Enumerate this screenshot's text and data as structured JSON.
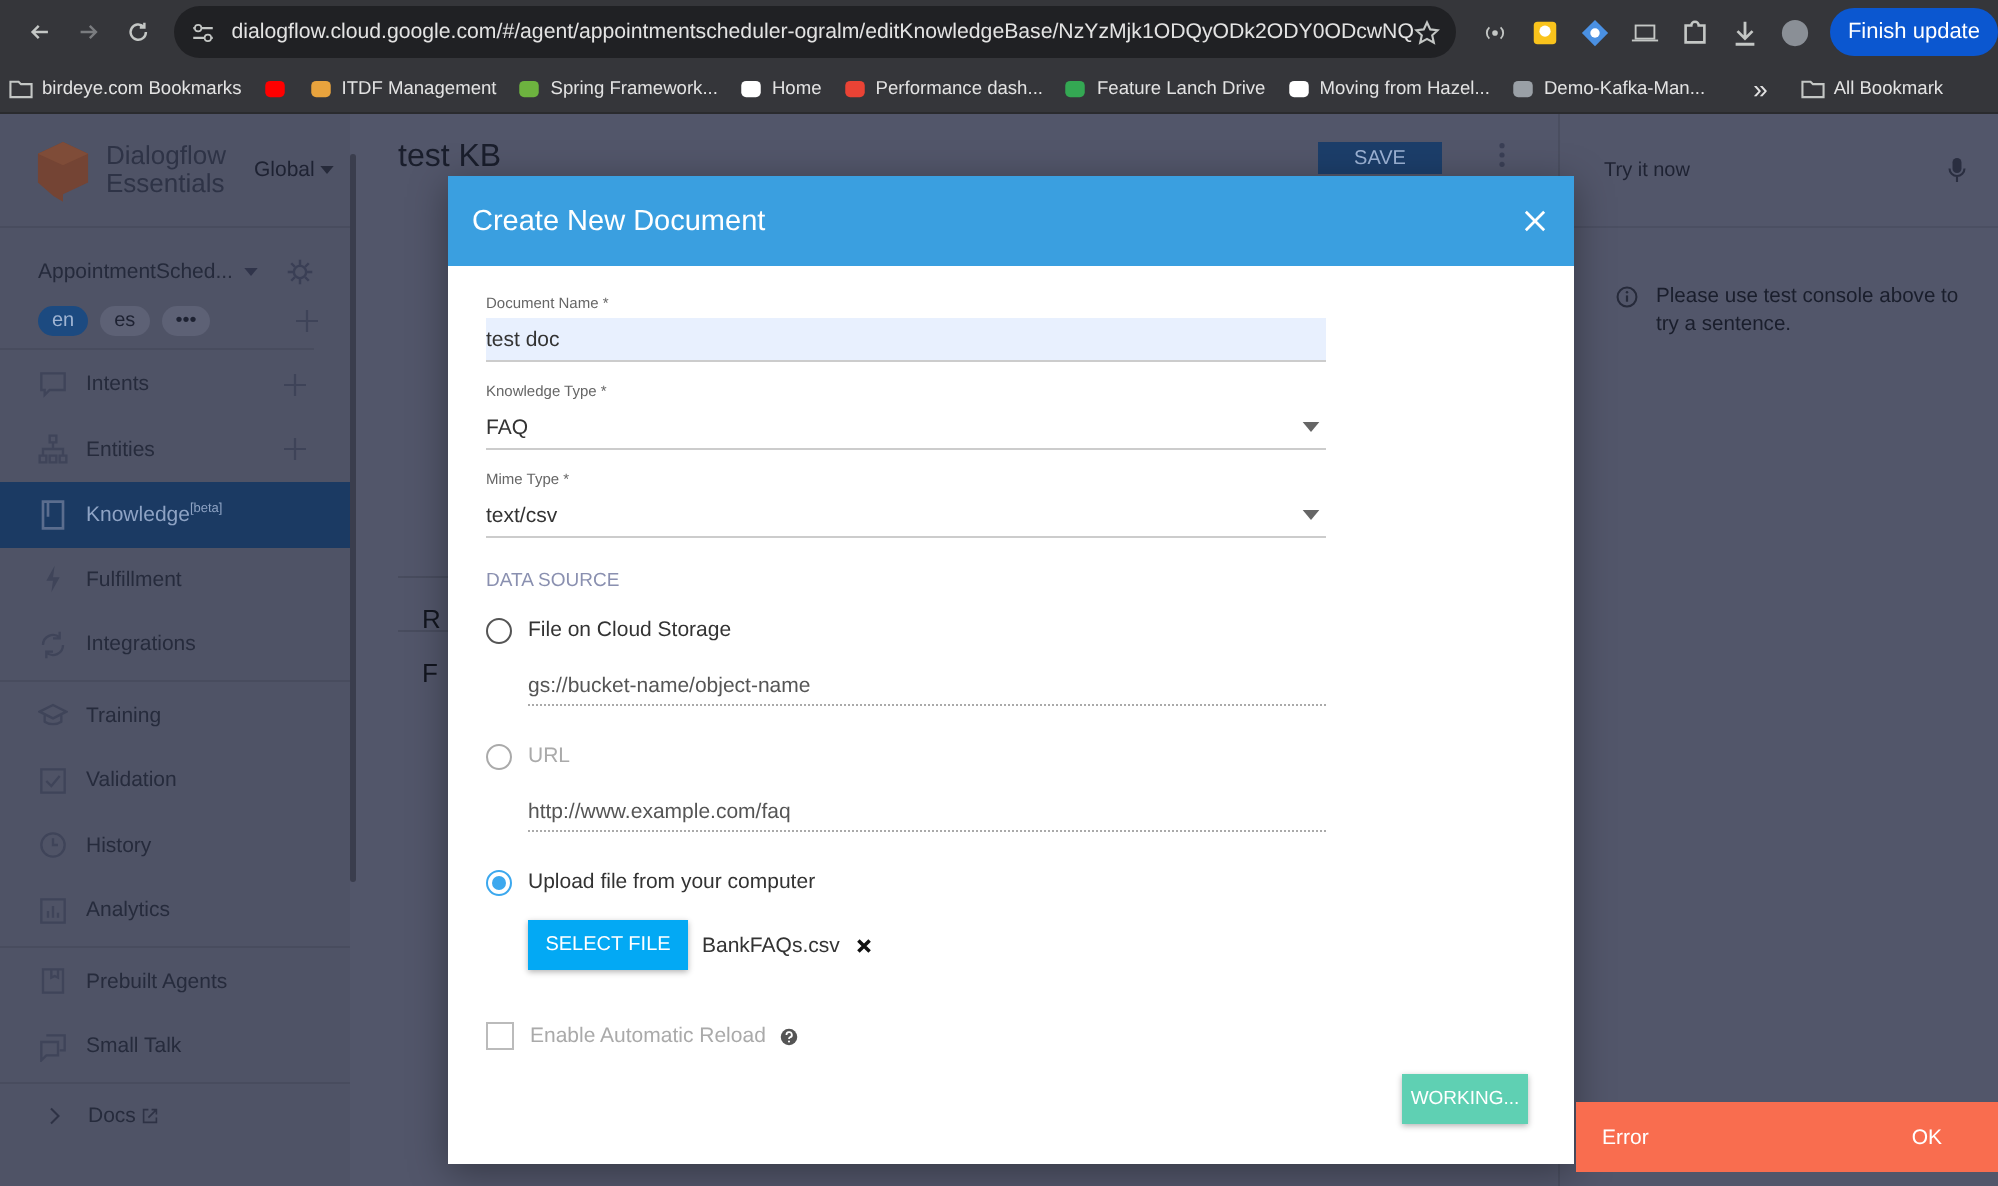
{
  "browser": {
    "url": "dialogflow.cloud.google.com/#/agent/appointmentscheduler-ogralm/editKnowledgeBase/NzYzMjk1ODQyODk2ODY0ODcwNQ",
    "update_button": "Finish update",
    "bookmarks": [
      {
        "kind": "folder",
        "label": "birdeye.com Bookmarks"
      },
      {
        "kind": "icon"
      },
      {
        "kind": "link",
        "label": "ITDF Management"
      },
      {
        "kind": "link",
        "label": "Spring Framework..."
      },
      {
        "kind": "link",
        "label": "Home"
      },
      {
        "kind": "link",
        "label": "Performance dash..."
      },
      {
        "kind": "link",
        "label": "Feature Lanch Drive"
      },
      {
        "kind": "link",
        "label": "Moving from Hazel..."
      },
      {
        "kind": "link",
        "label": "Demo-Kafka-Man..."
      }
    ],
    "more": "»",
    "all_bookmarks": "All Bookmark"
  },
  "sidebar": {
    "product": "Dialogflow Essentials",
    "region": "Global",
    "agent": "AppointmentSched...",
    "languages": [
      {
        "label": "en",
        "selected": true
      },
      {
        "label": "es",
        "selected": false
      },
      {
        "label": "•••",
        "selected": false
      }
    ],
    "sections": [
      [
        {
          "label": "Intents",
          "selected": false,
          "addable": true
        },
        {
          "label": "Entities",
          "selected": false,
          "addable": true
        },
        {
          "label": "Knowledge$^{[beta]}$",
          "selected": true,
          "addable": false
        },
        {
          "label": "Fulfillment",
          "selected": false,
          "addable": false
        },
        {
          "label": "Integrations",
          "selected": false,
          "addable": false
        }
      ],
      [
        {
          "label": "Training",
          "selected": false,
          "addable": false
        },
        {
          "label": "Validation",
          "selected": false,
          "addable": false
        },
        {
          "label": "History",
          "selected": false,
          "addable": false
        },
        {
          "label": "Analytics",
          "selected": false,
          "addable": false
        }
      ],
      [
        {
          "label": "Prebuilt Agents",
          "selected": false,
          "addable": false
        },
        {
          "label": "Small Talk",
          "selected": false,
          "addable": false
        }
      ]
    ],
    "docs": "Docs"
  },
  "main": {
    "title": "test KB",
    "save_button": "SAVE",
    "section_headings": [
      "R",
      "F"
    ]
  },
  "test_console": {
    "placeholder": "Try it now",
    "message": "Please use test console above to try a sentence."
  },
  "dialog": {
    "title": "Create New Document",
    "fields": [
      {
        "label": "Document Name *",
        "value": "test doc",
        "kind": "text"
      },
      {
        "label": "Knowledge Type *",
        "value": "FAQ",
        "kind": "select"
      },
      {
        "label": "Mime Type *",
        "value": "text/csv",
        "kind": "select"
      }
    ],
    "data_source": {
      "heading": "DATA SOURCE",
      "options": [
        {
          "label": "File on Cloud Storage",
          "selected": false,
          "disabled": false,
          "kind": "path",
          "placeholder": "gs://bucket-name/object-name"
        },
        {
          "label": "URL",
          "selected": false,
          "disabled": true,
          "kind": "path",
          "placeholder": "http://www.example.com/faq"
        },
        {
          "label": "Upload file from your computer",
          "selected": true,
          "disabled": false,
          "kind": "upload",
          "button": "SELECT FILE",
          "file_name": "BankFAQs.csv"
        }
      ]
    },
    "auto_reload": {
      "label": "Enable Automatic Reload",
      "checked": false,
      "disabled": true
    },
    "submit_button": "WORKING..."
  },
  "toast": {
    "message": "Error",
    "action": "OK"
  }
}
